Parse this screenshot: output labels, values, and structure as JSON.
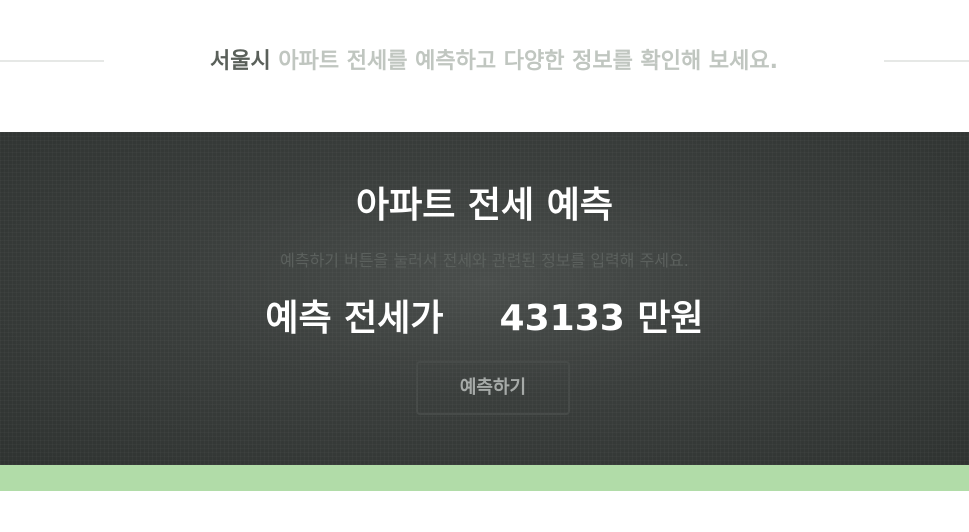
{
  "tagline": {
    "highlight": "서울시",
    "text": " 아파트 전세를 예측하고 다양한 정보를 확인해 보세요."
  },
  "hero": {
    "title": "아파트 전세 예측",
    "subtitle": "예측하기 버튼을 눌러서 전세와 관련된 정보를 입력해 주세요.",
    "result_label": "예측 전세가",
    "result_value": "43133 만원",
    "predict_button_label": "예측하기"
  },
  "colors": {
    "hero_background": "#3a3e3c",
    "accent_strip": "#b1dca8",
    "tagline_highlight": "#5a605a",
    "tagline_text": "#c0c6c0"
  }
}
